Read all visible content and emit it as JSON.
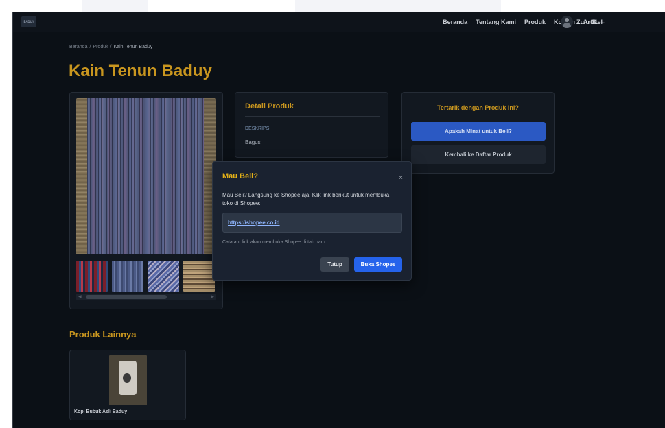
{
  "navbar": {
    "logo_text": "BADUY",
    "links": [
      "Beranda",
      "Tentang Kami",
      "Produk",
      "Konten",
      "Artikel"
    ],
    "user_name": "Zulu 11",
    "user_chevron": "⌄"
  },
  "breadcrumb": {
    "items": [
      "Beranda",
      "/",
      "Produk",
      "/",
      "Kain Tenun Baduy"
    ]
  },
  "page_title": "Kain Tenun Baduy",
  "detail": {
    "title": "Detail Produk",
    "label": "DESKRIPSI",
    "value": "Bagus"
  },
  "cta": {
    "title": "Tertarik dengan Produk Ini?",
    "primary_label": "Apakah Minat untuk Beli?",
    "secondary_label": "Kembali ke Daftar Produk"
  },
  "other_products": {
    "title": "Produk Lainnya",
    "items": [
      {
        "name": "Kopi Bubuk Asli Baduy"
      }
    ]
  },
  "modal": {
    "title": "Mau Beli?",
    "close_glyph": "×",
    "body": "Mau Beli? Langsung ke Shopee aja! Klik link berikut untuk membuka toko di Shopee:",
    "link": "https://shopee.co.id",
    "note": "Catatan: link akan membuka Shopee di tab baru.",
    "close_label": "Tutup",
    "open_label": "Buka Shopee"
  },
  "scrollbar": {
    "left_arrow": "◀",
    "right_arrow": "▶"
  },
  "colors": {
    "accent_gold": "#c9961f",
    "modal_title": "#e2b018",
    "primary_blue": "#2563eb",
    "background": "#0b1016"
  }
}
